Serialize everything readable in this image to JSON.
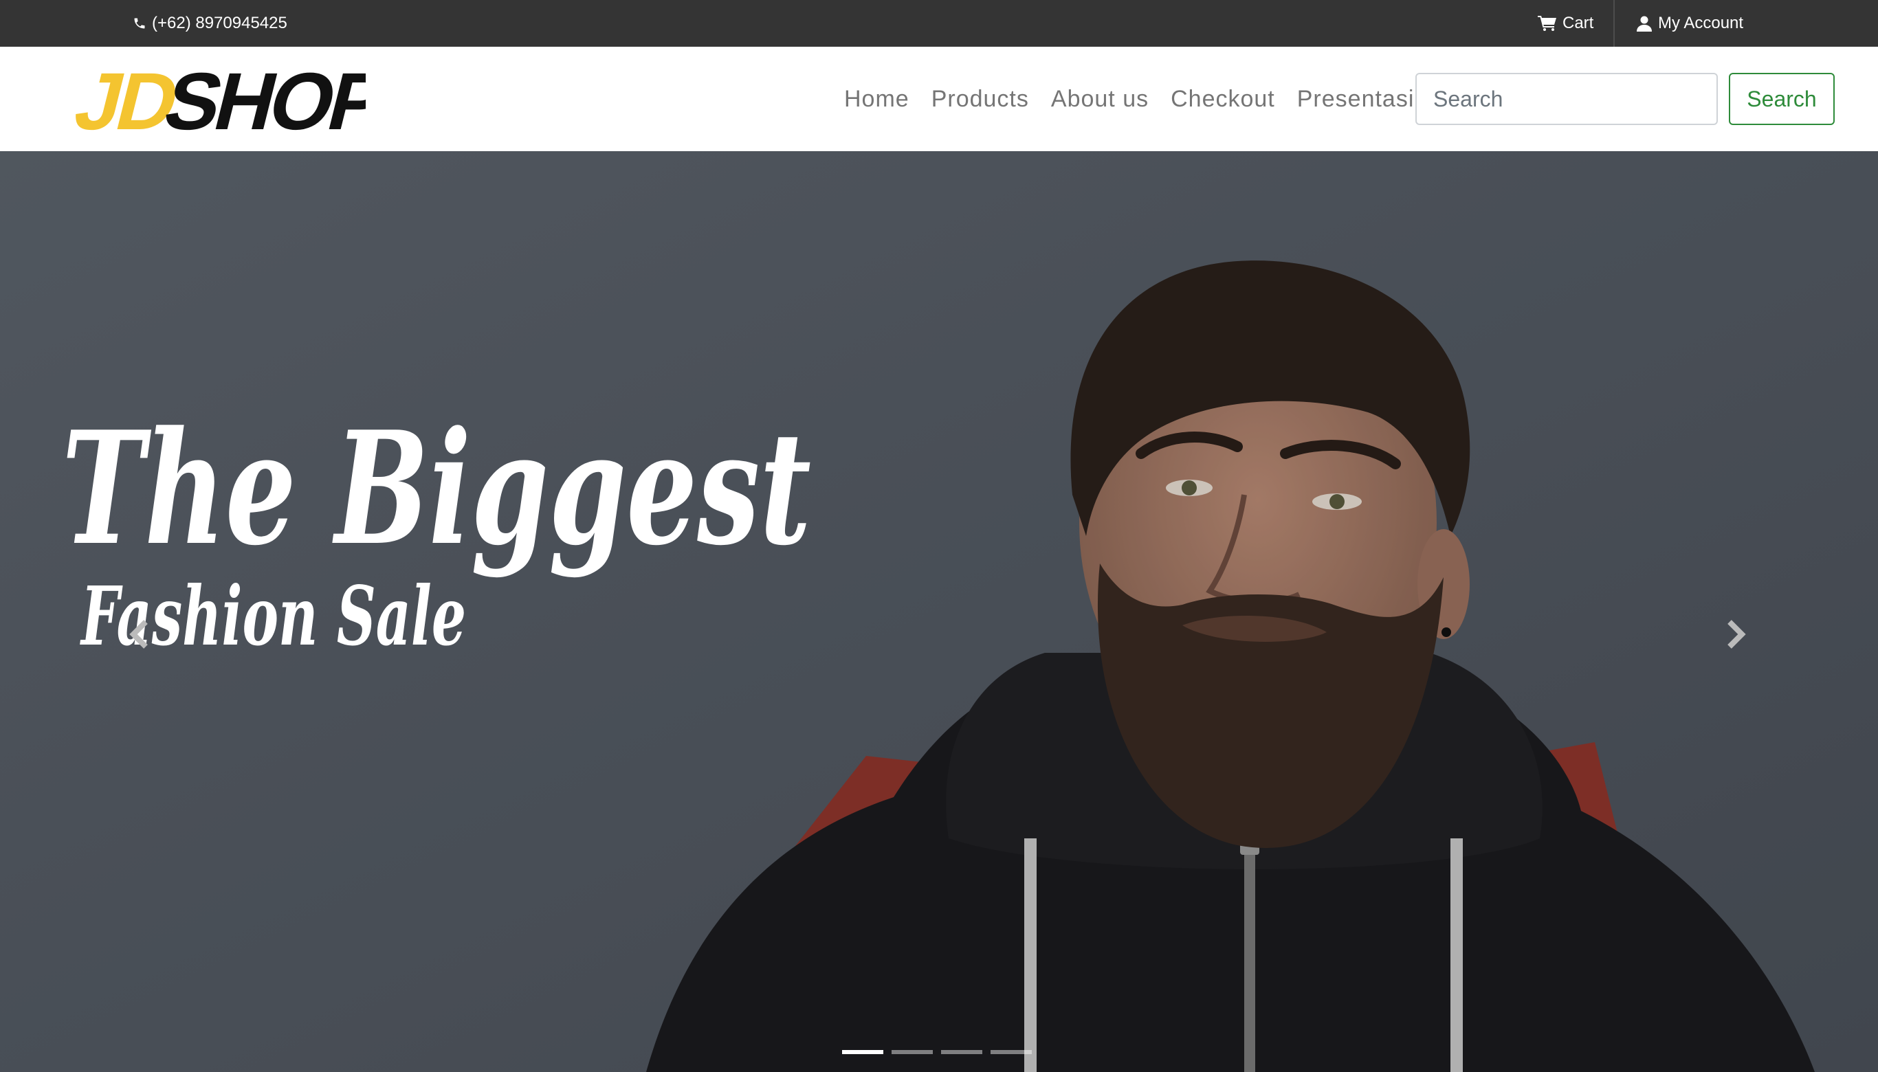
{
  "topbar": {
    "phone_icon": "phone-icon",
    "phone": "(+62) 8970945425",
    "cart_icon": "cart-icon",
    "cart_label": "Cart",
    "account_icon": "user-icon",
    "account_label": "My Account"
  },
  "brand": {
    "logo_part1": "JD",
    "logo_part2": "SHOP",
    "logo_colors": {
      "part1": "#f4c430",
      "part2": "#111111"
    }
  },
  "nav": {
    "items": [
      {
        "label": "Home"
      },
      {
        "label": "Products"
      },
      {
        "label": "About us"
      },
      {
        "label": "Checkout"
      },
      {
        "label": "Presentasi"
      }
    ]
  },
  "search": {
    "placeholder": "Search",
    "value": "",
    "button_label": "Search",
    "button_color": "#2e8b3a"
  },
  "carousel": {
    "headline_line1": "The Biggest",
    "headline_line2": "Fashion Sale",
    "prev_icon": "chevron-left-icon",
    "next_icon": "chevron-right-icon",
    "slide_count": 4,
    "active_slide": 1
  },
  "colors": {
    "topbar_bg": "#343434",
    "accent": "#2e8b3a",
    "nav_text": "#757575"
  }
}
